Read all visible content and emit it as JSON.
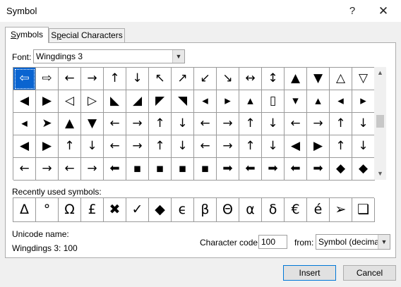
{
  "window": {
    "title": "Symbol",
    "help": "?",
    "close": "✕"
  },
  "tabs": [
    {
      "label": "Symbols",
      "mnemonic_index": 0,
      "active": true
    },
    {
      "label": "Special Characters",
      "mnemonic_index": 1,
      "active": false
    }
  ],
  "font": {
    "label": "Font:",
    "value": "Wingdings 3"
  },
  "symbol_grid": {
    "selected_index": 0,
    "rows": [
      [
        "⇦",
        "⇨",
        "←",
        "→",
        "↑",
        "↓",
        "↖",
        "↗",
        "↙",
        "↘",
        "↔",
        "↕",
        "▲",
        "▼",
        "△",
        "▽"
      ],
      [
        "◀",
        "▶",
        "◁",
        "▷",
        "◣",
        "◢",
        "◤",
        "◥",
        "◂",
        "▸",
        "▴",
        "▯",
        "▾",
        "▴",
        "◂",
        "▸"
      ],
      [
        "◂",
        "➤",
        "▲",
        "▼",
        "←",
        "→",
        "↑",
        "↓",
        "←",
        "→",
        "↑",
        "↓",
        "←",
        "→",
        "↑",
        "↓"
      ],
      [
        "◀",
        "▶",
        "↑",
        "↓",
        "←",
        "→",
        "↑",
        "↓",
        "←",
        "→",
        "↑",
        "↓",
        "◀",
        "▶",
        "↑",
        "↓"
      ],
      [
        "←",
        "→",
        "←",
        "→",
        "⬅",
        "▪",
        "▪",
        "▪",
        "▪",
        "➡",
        "⬅",
        "➡",
        "⬅",
        "➡",
        "◆",
        "◆"
      ]
    ]
  },
  "recent": {
    "label": "Recently used symbols:",
    "symbols": [
      "Δ",
      "°",
      "Ω",
      "£",
      "✖",
      "✓",
      "◆",
      "ϵ",
      "β",
      "Θ",
      "α",
      "δ",
      "€",
      "é",
      "➢",
      "❑"
    ]
  },
  "unicode": {
    "label": "Unicode name:",
    "value": "Wingdings 3: 100"
  },
  "character_code": {
    "label": "Character code:",
    "value": "100"
  },
  "from": {
    "label": "from:",
    "value": "Symbol (decimal)"
  },
  "buttons": {
    "insert": "Insert",
    "cancel": "Cancel"
  },
  "colors": {
    "selection": "#0a64d0",
    "accent_border": "#0078d7"
  }
}
